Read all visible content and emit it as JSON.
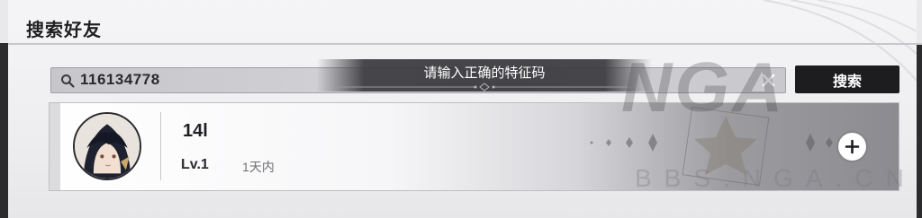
{
  "header": {
    "title": "搜索好友"
  },
  "search": {
    "value": "116134778",
    "button_label": "搜索"
  },
  "toast": {
    "message": "请输入正确的特征码"
  },
  "friend": {
    "name": "14l",
    "level": "Lv.1",
    "last_online": "1天内"
  },
  "watermark": {
    "top_text": "NGA",
    "bottom_text": "BBS.NGA.CN"
  },
  "icons": {
    "search": "search-icon",
    "clear": "close-icon",
    "add": "plus-icon",
    "avatar": "character-portrait"
  },
  "colors": {
    "button_bg": "#1d1d20",
    "toast_bg": "#3c3c40",
    "panel_bg": "#f2f2f4"
  }
}
